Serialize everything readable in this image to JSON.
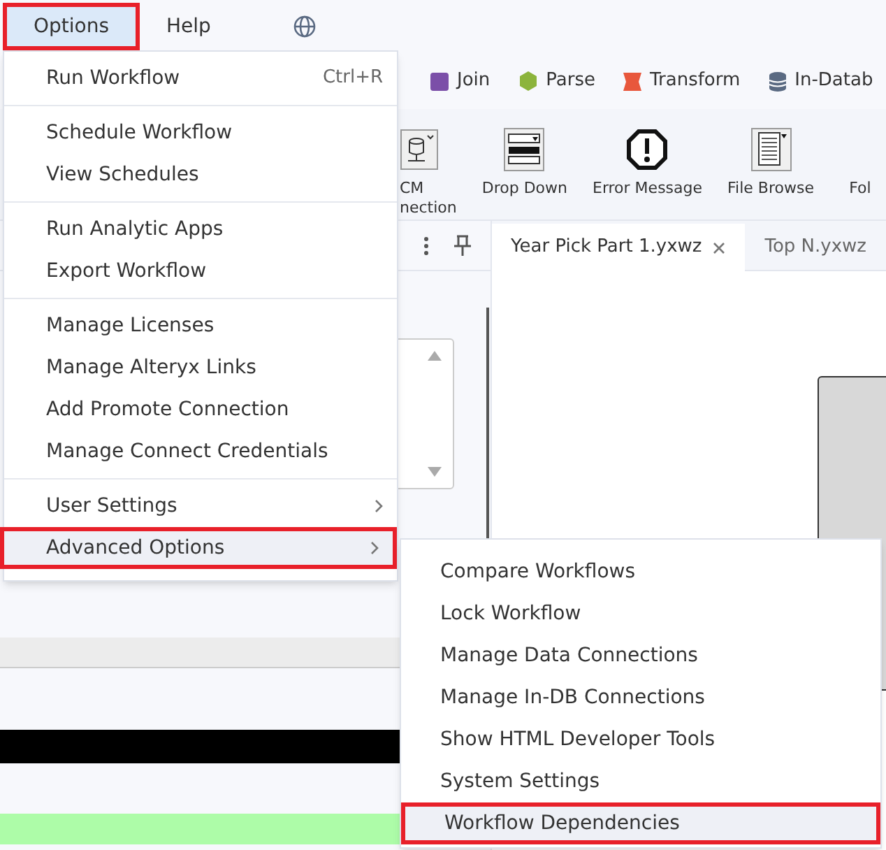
{
  "menubar": [
    {
      "label": "Options",
      "selected": true,
      "annotated": true
    },
    {
      "label": "Help",
      "selected": false,
      "annotated": false
    }
  ],
  "categories": [
    {
      "label": "Join",
      "color": "#7b4fa8",
      "kind": "square"
    },
    {
      "label": "Parse",
      "color": "#8cb43c",
      "kind": "hexagon"
    },
    {
      "label": "Transform",
      "color": "#e8573c",
      "kind": "ribbon"
    },
    {
      "label": "In-Datab",
      "color": "#5a6a82",
      "kind": "database"
    }
  ],
  "tools": [
    {
      "label": "CM",
      "label_2": "nection",
      "kind": "database"
    },
    {
      "label": "Drop Down",
      "kind": "dropdown"
    },
    {
      "label": "Error Message",
      "kind": "error"
    },
    {
      "label": "File Browse",
      "kind": "file"
    },
    {
      "label": "Fol",
      "kind": "none"
    }
  ],
  "doc_tabs": [
    {
      "label": "Year Pick Part 1.yxwz",
      "selected": true,
      "closable": true
    },
    {
      "label": "Top N.yxwz",
      "selected": false,
      "closable": false
    }
  ],
  "menu": {
    "groups": [
      [
        {
          "label": "Run Workflow",
          "shortcut": "Ctrl+R",
          "submenu": false,
          "highlighted": false,
          "annotated": false
        }
      ],
      [
        {
          "label": "Schedule Workflow",
          "submenu": false,
          "highlighted": false,
          "annotated": false
        },
        {
          "label": "View Schedules",
          "submenu": false,
          "highlighted": false,
          "annotated": false
        }
      ],
      [
        {
          "label": "Run Analytic Apps",
          "submenu": false,
          "highlighted": false,
          "annotated": false
        },
        {
          "label": "Export Workflow",
          "submenu": false,
          "highlighted": false,
          "annotated": false
        }
      ],
      [
        {
          "label": "Manage Licenses",
          "submenu": false,
          "highlighted": false,
          "annotated": false
        },
        {
          "label": "Manage Alteryx Links",
          "submenu": false,
          "highlighted": false,
          "annotated": false
        },
        {
          "label": "Add Promote Connection",
          "submenu": false,
          "highlighted": false,
          "annotated": false
        },
        {
          "label": "Manage Connect Credentials",
          "submenu": false,
          "highlighted": false,
          "annotated": false
        }
      ],
      [
        {
          "label": "User Settings",
          "submenu": true,
          "highlighted": false,
          "annotated": false
        },
        {
          "label": "Advanced Options",
          "submenu": true,
          "highlighted": true,
          "annotated": true
        }
      ]
    ]
  },
  "submenu": {
    "items": [
      {
        "label": "Compare Workflows",
        "highlighted": false,
        "annotated": false
      },
      {
        "label": "Lock Workflow",
        "highlighted": false,
        "annotated": false
      },
      {
        "label": "Manage Data Connections",
        "highlighted": false,
        "annotated": false
      },
      {
        "label": "Manage In-DB Connections",
        "highlighted": false,
        "annotated": false
      },
      {
        "label": "Show HTML Developer Tools",
        "highlighted": false,
        "annotated": false
      },
      {
        "label": "System Settings",
        "highlighted": false,
        "annotated": false
      },
      {
        "label": "Workflow Dependencies",
        "highlighted": true,
        "annotated": true
      }
    ]
  }
}
